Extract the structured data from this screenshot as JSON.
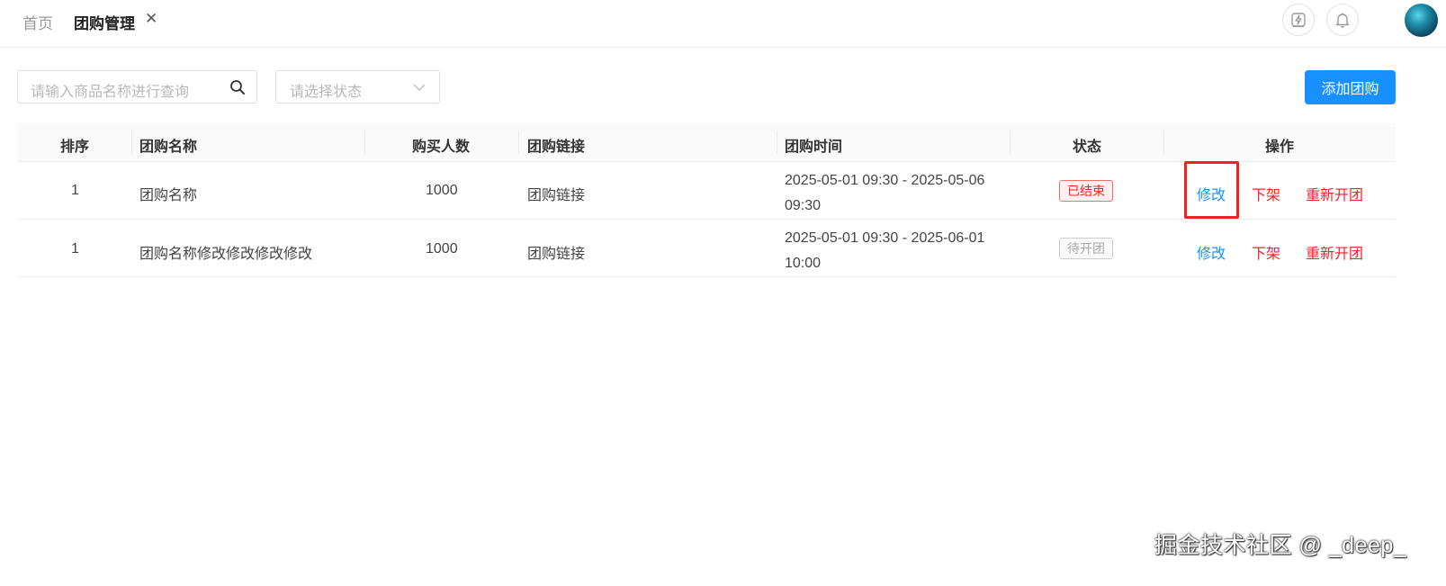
{
  "tabs": {
    "home": "首页",
    "active": "团购管理",
    "close_glyph": "✕"
  },
  "header_icons": [
    "lightning-icon",
    "bell-icon"
  ],
  "filters": {
    "search_placeholder": "请输入商品名称进行查询",
    "status_placeholder": "请选择状态"
  },
  "add_button": "添加团购",
  "table": {
    "columns": [
      "排序",
      "团购名称",
      "购买人数",
      "团购链接",
      "团购时间",
      "状态",
      "操作"
    ],
    "rows": [
      {
        "sort": "1",
        "name": "团购名称",
        "count": "1000",
        "link": "团购链接",
        "time_line1": "2025-05-01 09:30 - 2025-05-06",
        "time_line2": "09:30",
        "status": "已结束",
        "status_kind": "ended",
        "actions": [
          "修改",
          "下架",
          "重新开团"
        ]
      },
      {
        "sort": "1",
        "name": "团购名称修改修改修改修改",
        "count": "1000",
        "link": "团购链接",
        "time_line1": "2025-05-01 09:30 - 2025-06-01",
        "time_line2": "10:00",
        "status": "待开团",
        "status_kind": "pending",
        "actions": [
          "修改",
          "下架",
          "重新开团"
        ]
      }
    ]
  },
  "colors": {
    "primary": "#1890ff",
    "danger": "#f5222d",
    "highlight": "#e8281e"
  },
  "watermark": "掘金技术社区 @ _deep_"
}
